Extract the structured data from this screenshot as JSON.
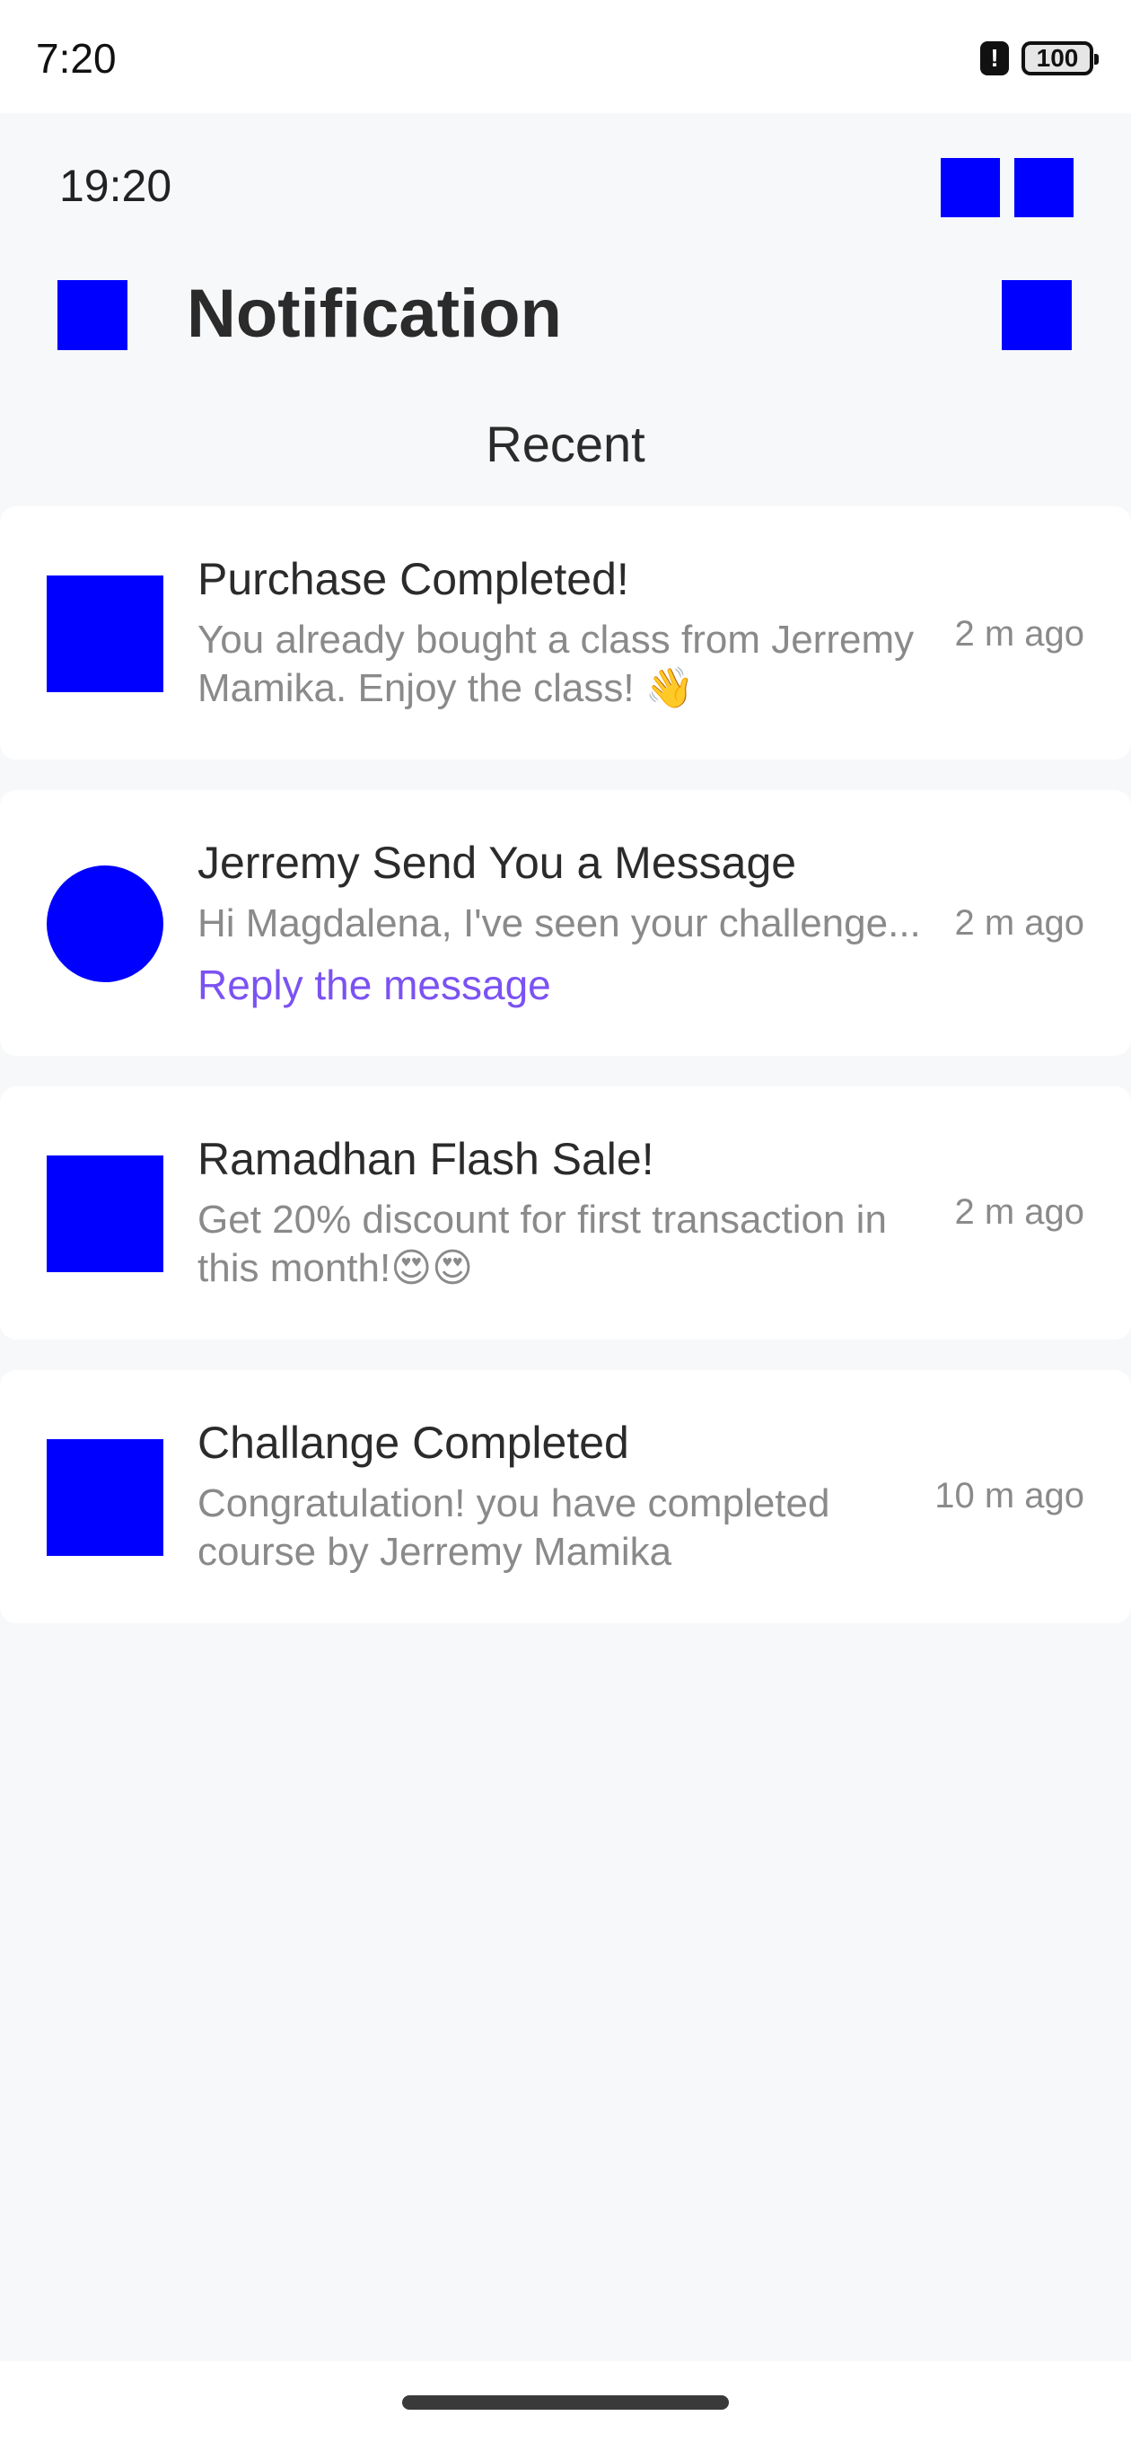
{
  "system_status": {
    "time": "7:20",
    "alert_glyph": "!",
    "battery": "100"
  },
  "app": {
    "time": "19:20",
    "title": "Notification",
    "section": "Recent"
  },
  "notifications": [
    {
      "title": "Purchase Completed!",
      "body": "You already bought a class from Jerremy Mamika. Enjoy the class! 👋",
      "time": "2 m ago"
    },
    {
      "title": "Jerremy Send You a Message",
      "body": "Hi Magdalena, I've seen your challenge...",
      "time": "2 m ago",
      "link": "Reply the message"
    },
    {
      "title": "Ramadhan Flash Sale!",
      "body": "Get 20% discount for first transaction in this month!😍😍",
      "time": "2 m ago"
    },
    {
      "title": "Challange Completed",
      "body": "Congratulation! you have completed course by Jerremy Mamika",
      "time": "10 m ago"
    }
  ],
  "colors": {
    "accent": "#7b52f2",
    "placeholder": "#0000ff",
    "background": "#f7f8fa"
  }
}
